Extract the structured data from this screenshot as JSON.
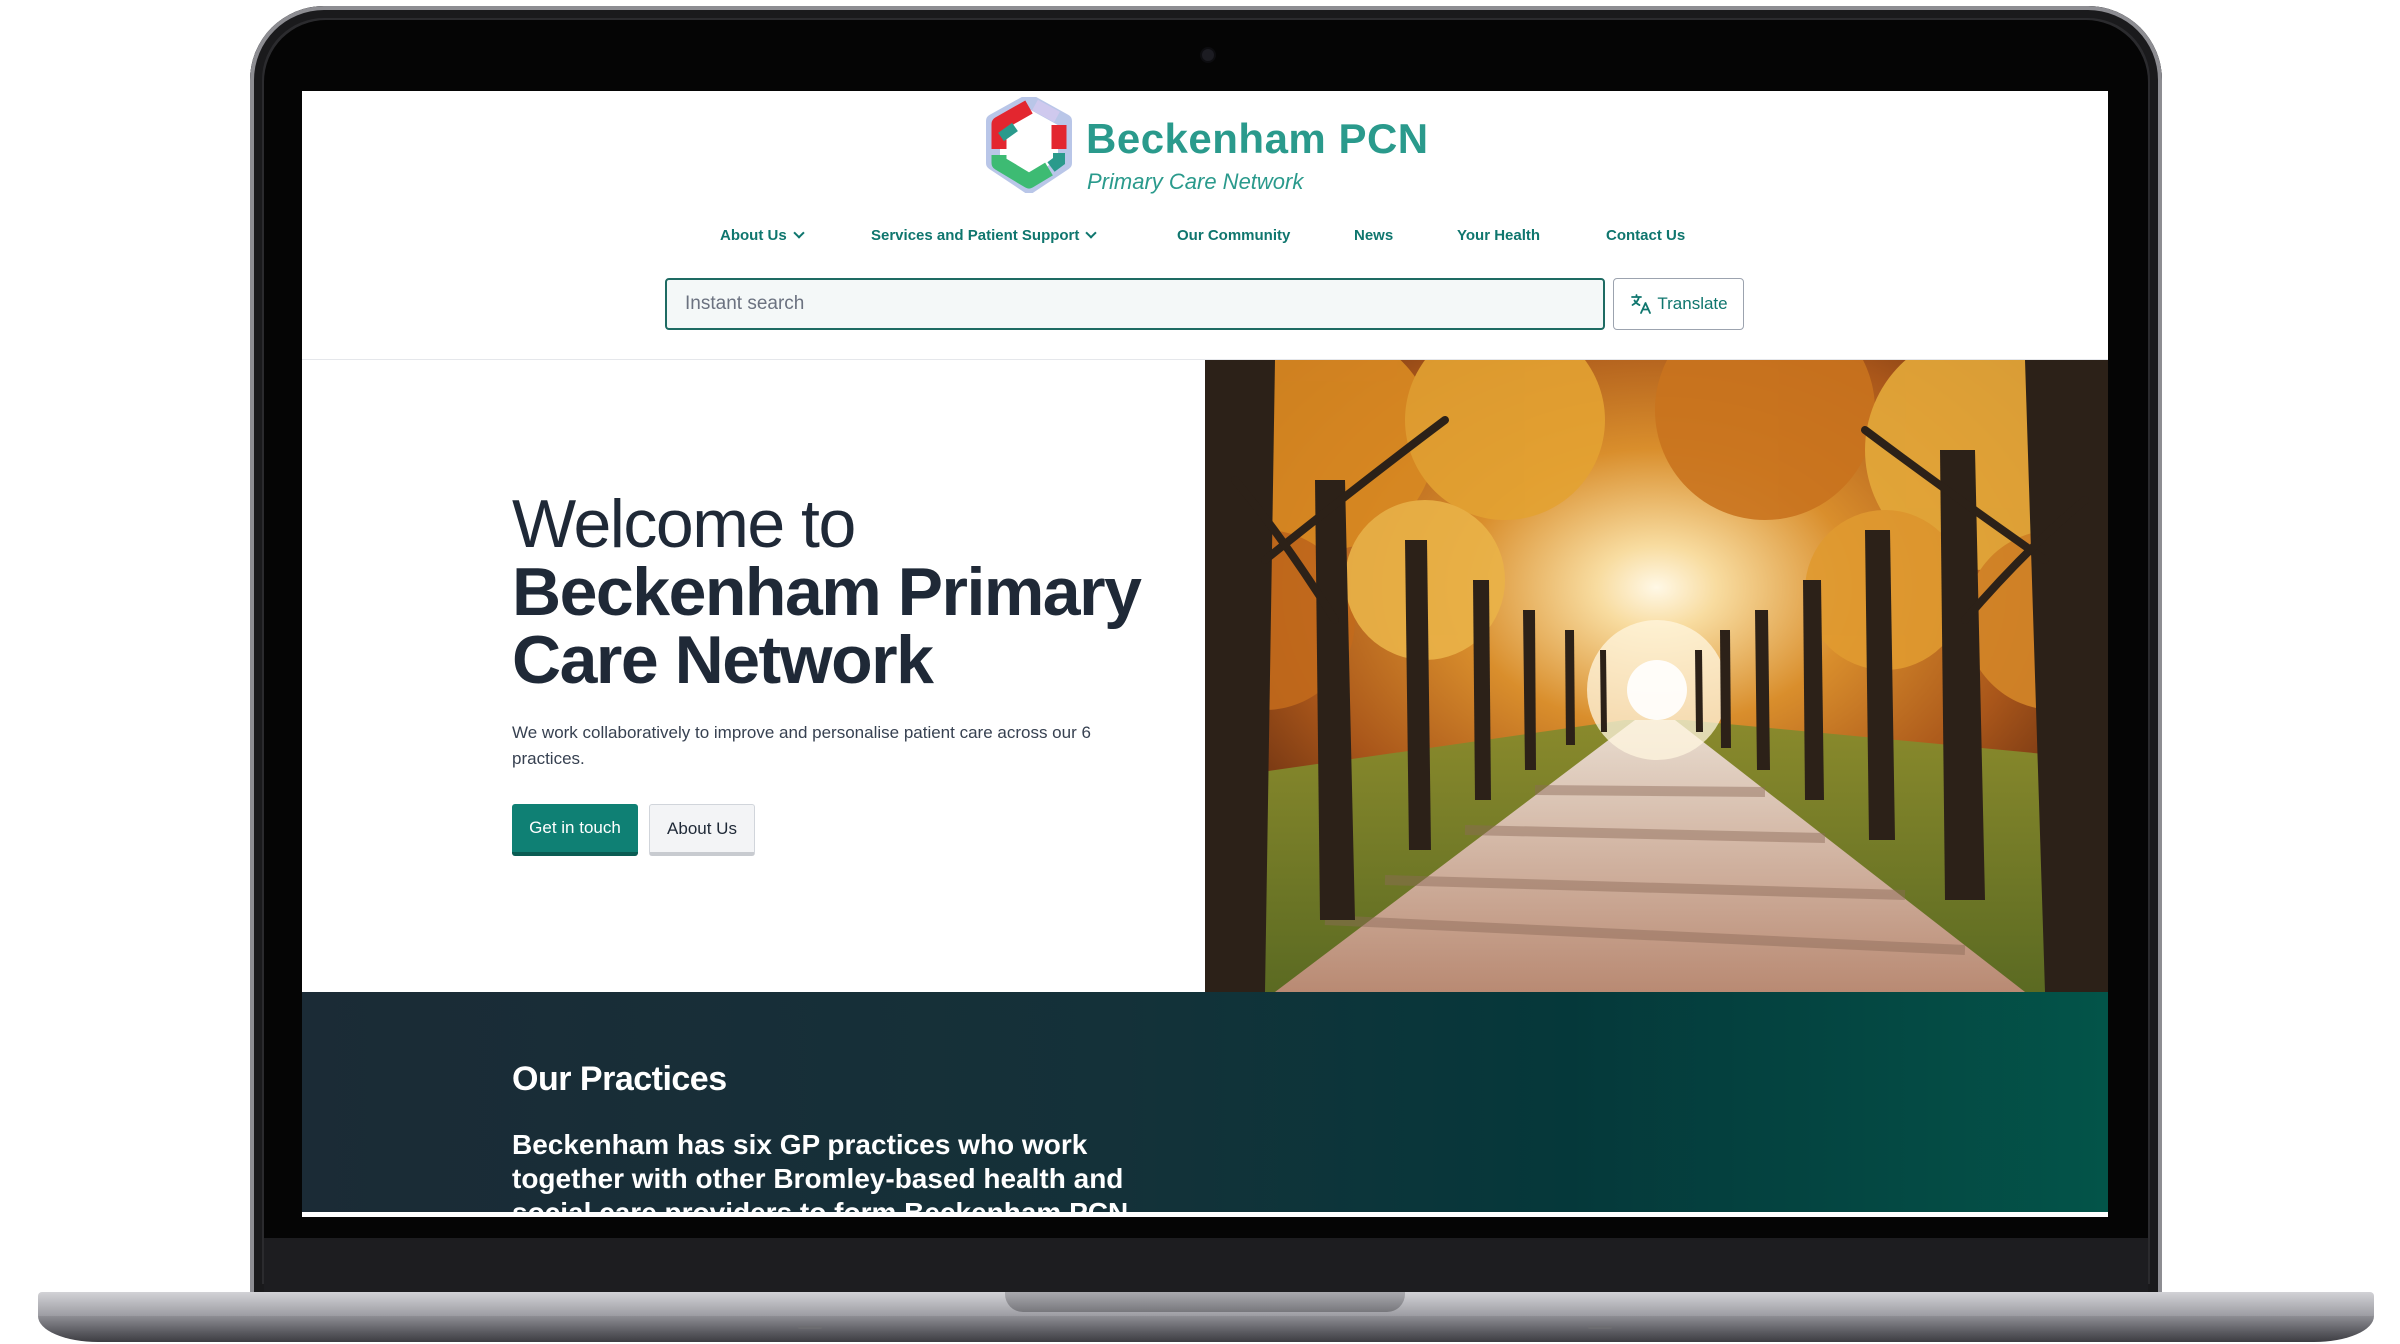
{
  "site": {
    "logo_title": "Beckenham PCN",
    "logo_subtitle": "Primary Care Network"
  },
  "nav": {
    "items": [
      {
        "label": "About Us",
        "dropdown": true
      },
      {
        "label": "Services and Patient Support",
        "dropdown": true
      },
      {
        "label": "Our Community",
        "dropdown": false
      },
      {
        "label": "News",
        "dropdown": false
      },
      {
        "label": "Your Health",
        "dropdown": false
      },
      {
        "label": "Contact Us",
        "dropdown": false
      }
    ]
  },
  "search": {
    "placeholder": "Instant search",
    "value": ""
  },
  "translate": {
    "label": "Translate",
    "icon": "translate-icon"
  },
  "hero": {
    "heading_light": "Welcome to",
    "heading_bold": "Beckenham Primary Care Network",
    "text": "We work collaboratively to improve and personalise patient care across our 6 practices.",
    "primary_button": "Get in touch",
    "secondary_button": "About Us",
    "image": "autumn-tree-lined-path"
  },
  "practices": {
    "title_light": "Our",
    "title_bold": "Practices",
    "text": "Beckenham has six GP practices who work together with other Bromley-based health and social care providers to form Beckenham PCN"
  },
  "colors": {
    "brand_teal": "#2a9a8c",
    "nav_teal": "#0f766e",
    "button_teal": "#0f8074",
    "band_dark": "#1b2b36",
    "band_green": "#035449"
  }
}
